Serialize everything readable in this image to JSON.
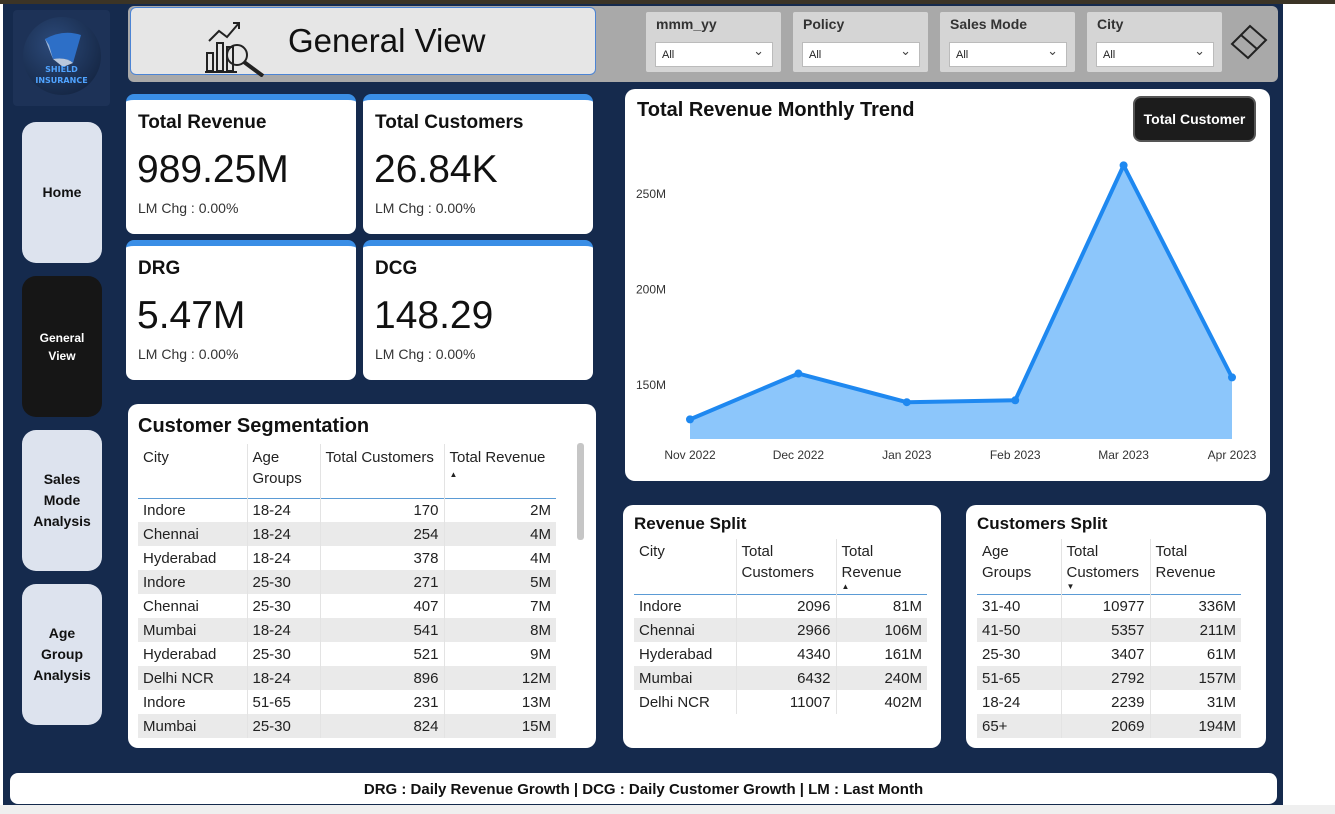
{
  "brand": {
    "logo_text_1": "SHIELD",
    "logo_text_2": "INSURANCE"
  },
  "nav": {
    "home": "Home",
    "general_view_1": "General",
    "general_view_2": "View",
    "sales_mode_1": "Sales",
    "sales_mode_2": "Mode",
    "sales_mode_3": "Analysis",
    "age_group_1": "Age",
    "age_group_2": "Group",
    "age_group_3": "Analysis"
  },
  "header": {
    "title": "General View"
  },
  "filters": [
    {
      "label": "mmm_yy",
      "value": "All"
    },
    {
      "label": "Policy",
      "value": "All"
    },
    {
      "label": "Sales Mode",
      "value": "All"
    },
    {
      "label": "City",
      "value": "All"
    }
  ],
  "kpis": [
    {
      "title": "Total Revenue",
      "value": "989.25M",
      "sub": "LM Chg : 0.00%"
    },
    {
      "title": "Total Customers",
      "value": "26.84K",
      "sub": "LM Chg : 0.00%"
    },
    {
      "title": "DRG",
      "value": "5.47M",
      "sub": "LM Chg : 0.00%"
    },
    {
      "title": "DCG",
      "value": "148.29",
      "sub": "LM Chg : 0.00%"
    }
  ],
  "segmentation": {
    "title": "Customer Segmentation",
    "headers": {
      "city": "City",
      "age_1": "Age",
      "age_2": "Groups",
      "customers": "Total Customers",
      "revenue": "Total Revenue"
    },
    "rows": [
      [
        "Indore",
        "18-24",
        "170",
        "2M"
      ],
      [
        "Chennai",
        "18-24",
        "254",
        "4M"
      ],
      [
        "Hyderabad",
        "18-24",
        "378",
        "4M"
      ],
      [
        "Indore",
        "25-30",
        "271",
        "5M"
      ],
      [
        "Chennai",
        "25-30",
        "407",
        "7M"
      ],
      [
        "Mumbai",
        "18-24",
        "541",
        "8M"
      ],
      [
        "Hyderabad",
        "25-30",
        "521",
        "9M"
      ],
      [
        "Delhi NCR",
        "18-24",
        "896",
        "12M"
      ],
      [
        "Indore",
        "51-65",
        "231",
        "13M"
      ],
      [
        "Mumbai",
        "25-30",
        "824",
        "15M"
      ]
    ]
  },
  "trend": {
    "title": "Total Revenue Monthly Trend",
    "toggle_label": "Total Customer"
  },
  "chart_data": {
    "type": "area",
    "title": "Total Revenue Monthly Trend",
    "categories": [
      "Nov 2022",
      "Dec 2022",
      "Jan 2023",
      "Feb 2023",
      "Mar 2023",
      "Apr 2023"
    ],
    "values": [
      132,
      156,
      141,
      142,
      265,
      154
    ],
    "y_ticks": [
      "250M",
      "200M",
      "150M"
    ],
    "y_tick_values": [
      250,
      200,
      150
    ],
    "ylim": [
      120,
      280
    ],
    "units": "M",
    "color": "#1e88f0",
    "fill": "#8cc6fb",
    "grid": false
  },
  "revenue_split": {
    "title": "Revenue Split",
    "headers": {
      "city": "City",
      "cust_1": "Total",
      "cust_2": "Customers",
      "rev_1": "Total",
      "rev_2": "Revenue"
    },
    "rows": [
      [
        "Indore",
        "2096",
        "81M"
      ],
      [
        "Chennai",
        "2966",
        "106M"
      ],
      [
        "Hyderabad",
        "4340",
        "161M"
      ],
      [
        "Mumbai",
        "6432",
        "240M"
      ],
      [
        "Delhi NCR",
        "11007",
        "402M"
      ]
    ]
  },
  "customers_split": {
    "title": "Customers Split",
    "headers": {
      "age_1": "Age",
      "age_2": "Groups",
      "cust_1": "Total",
      "cust_2": "Customers",
      "rev_1": "Total",
      "rev_2": "Revenue"
    },
    "rows": [
      [
        "31-40",
        "10977",
        "336M"
      ],
      [
        "41-50",
        "5357",
        "211M"
      ],
      [
        "25-30",
        "3407",
        "61M"
      ],
      [
        "51-65",
        "2792",
        "157M"
      ],
      [
        "18-24",
        "2239",
        "31M"
      ],
      [
        "65+",
        "2069",
        "194M"
      ]
    ]
  },
  "footer": {
    "text": "DRG : Daily Revenue Growth | DCG : Daily Customer Growth | LM : Last Month"
  },
  "colors": {
    "background": "#152a4d",
    "accent": "#3a8ee6",
    "line": "#1e88f0",
    "area": "#8cc6fb"
  }
}
